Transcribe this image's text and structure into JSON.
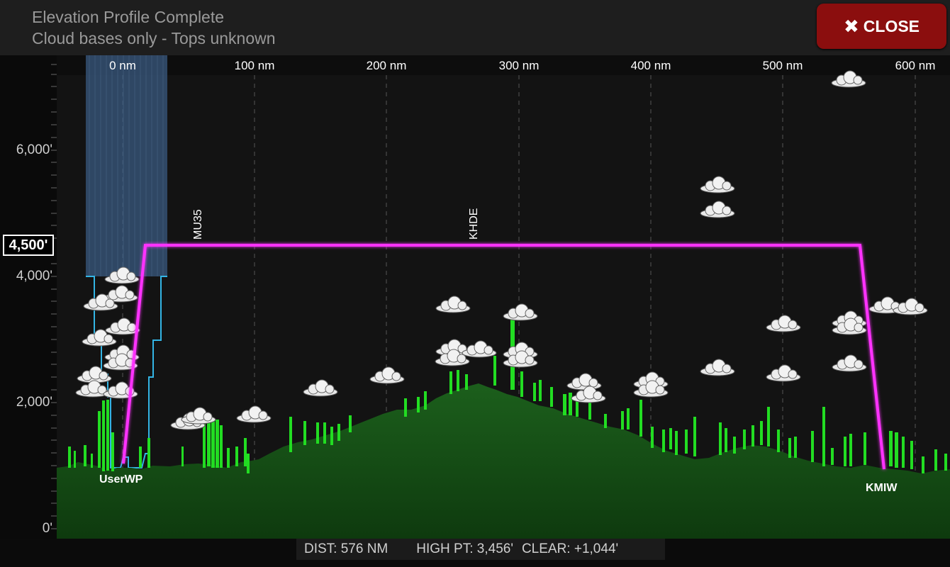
{
  "header": {
    "title": "Elevation Profile Complete",
    "subtitle": "Cloud bases only - Tops unknown",
    "close_label": "CLOSE",
    "close_icon": "close-x-icon"
  },
  "axis": {
    "altitude_labels": [
      "6,000'",
      "4,000'",
      "2,000'",
      "0'"
    ],
    "cruise_altitude": "4,500'",
    "distance_labels": [
      "0 nm",
      "100 nm",
      "200 nm",
      "300 nm",
      "400 nm",
      "500 nm",
      "600 nm"
    ]
  },
  "waypoints": {
    "start": "UserWP",
    "mid1": "MU35",
    "mid2": "KHDE",
    "end": "KMIW"
  },
  "stats": {
    "dist": "DIST: 576 NM",
    "high_pt": "HIGH PT: 3,456'",
    "clear": "CLEAR: +1,044'"
  },
  "colors": {
    "route": "#ff33ff",
    "terrain": "#1a5a1a",
    "obstacle": "#22dd22",
    "cloud_zone": "#6aa0d8",
    "close_button": "#8b0e0e"
  }
}
